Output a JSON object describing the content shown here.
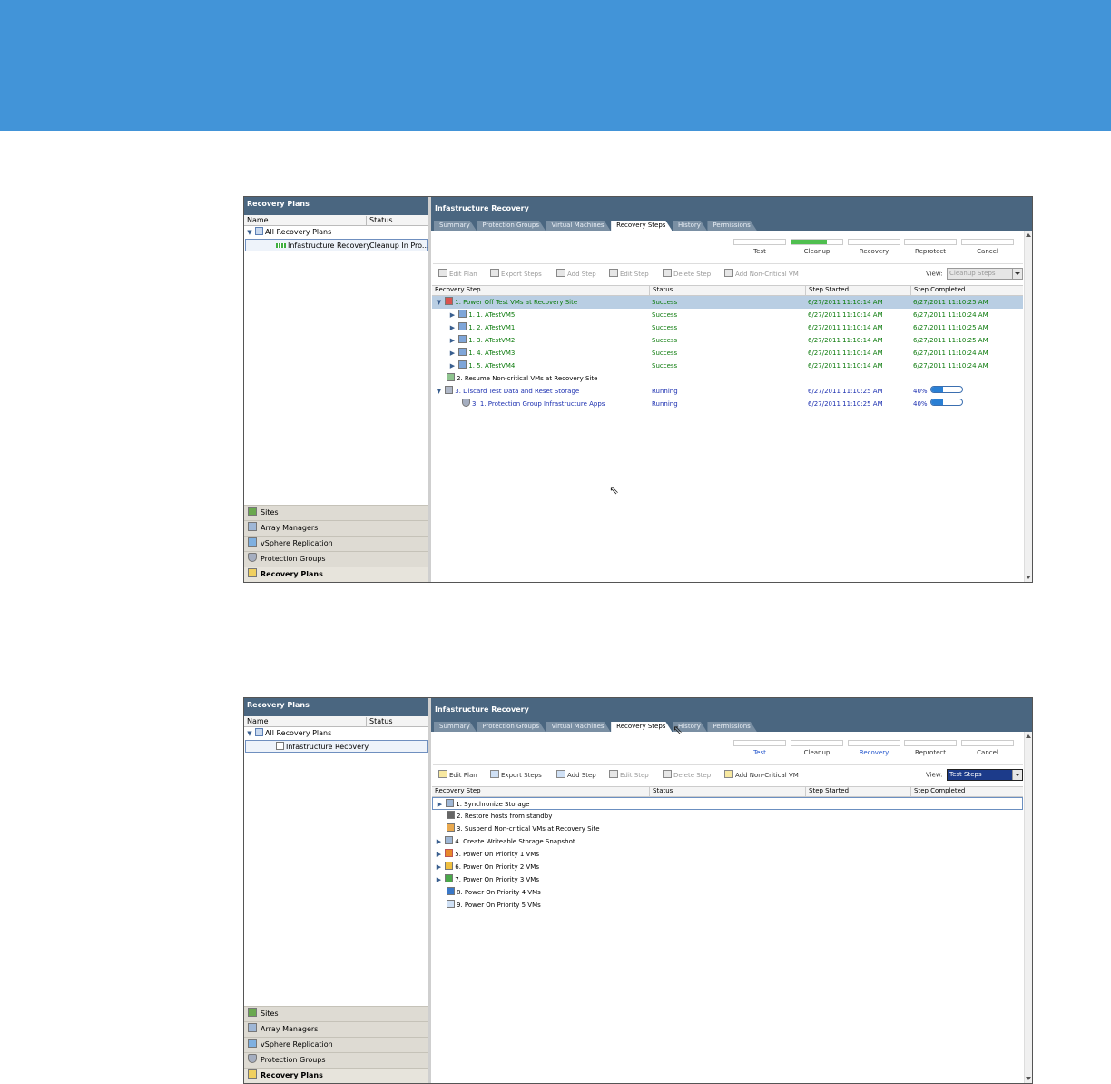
{
  "shots": [
    {
      "left": {
        "title": "Recovery Plans",
        "col_name": "Name",
        "col_status": "Status",
        "tree": [
          {
            "label": "All Recovery Plans",
            "status": ""
          },
          {
            "label": "Infastructure Recovery",
            "status": "Cleanup In Pro..."
          }
        ],
        "nav": [
          "Sites",
          "Array Managers",
          "vSphere Replication",
          "Protection Groups",
          "Recovery Plans"
        ]
      },
      "right": {
        "title": "Infastructure Recovery",
        "tabs": [
          "Summary",
          "Protection Groups",
          "Virtual Machines",
          "Recovery Steps",
          "History",
          "Permissions"
        ],
        "ops": [
          {
            "label": "Test",
            "progress": 0
          },
          {
            "label": "Cleanup",
            "progress": 0.7
          },
          {
            "label": "Recovery",
            "progress": 0
          },
          {
            "label": "Reprotect",
            "progress": 0
          },
          {
            "label": "Cancel",
            "progress": 0
          }
        ],
        "toolbar": [
          "Edit Plan",
          "Export Steps",
          "Add Step",
          "Edit Step",
          "Delete Step",
          "Add Non-Critical VM"
        ],
        "view_label": "View:",
        "view_value": "Cleanup Steps",
        "columns": [
          "Recovery Step",
          "Status",
          "Step Started",
          "Step Completed"
        ],
        "rows": [
          {
            "step": "1. Power Off Test VMs at Recovery Site",
            "status": "Success",
            "started": "6/27/2011 11:10:14 AM",
            "completed": "6/27/2011 11:10:25 AM"
          },
          {
            "step": "1. 1. ATestVM5",
            "status": "Success",
            "started": "6/27/2011 11:10:14 AM",
            "completed": "6/27/2011 11:10:24 AM"
          },
          {
            "step": "1. 2. ATestVM1",
            "status": "Success",
            "started": "6/27/2011 11:10:14 AM",
            "completed": "6/27/2011 11:10:25 AM"
          },
          {
            "step": "1. 3. ATestVM2",
            "status": "Success",
            "started": "6/27/2011 11:10:14 AM",
            "completed": "6/27/2011 11:10:25 AM"
          },
          {
            "step": "1. 4. ATestVM3",
            "status": "Success",
            "started": "6/27/2011 11:10:14 AM",
            "completed": "6/27/2011 11:10:24 AM"
          },
          {
            "step": "1. 5. ATestVM4",
            "status": "Success",
            "started": "6/27/2011 11:10:14 AM",
            "completed": "6/27/2011 11:10:24 AM"
          },
          {
            "step": "2. Resume Non-critical VMs at Recovery Site",
            "status": "",
            "started": "",
            "completed": ""
          },
          {
            "step": "3. Discard Test Data and Reset Storage",
            "status": "Running",
            "started": "6/27/2011 11:10:25 AM",
            "completed": "40%",
            "progress": 0.4
          },
          {
            "step": "3. 1. Protection Group Infrastructure Apps",
            "status": "Running",
            "started": "6/27/2011 11:10:25 AM",
            "completed": "40%",
            "progress": 0.4
          }
        ]
      }
    },
    {
      "left": {
        "title": "Recovery Plans",
        "col_name": "Name",
        "col_status": "Status",
        "tree": [
          {
            "label": "All Recovery Plans",
            "status": ""
          },
          {
            "label": "Infastructure Recovery",
            "status": ""
          }
        ],
        "nav": [
          "Sites",
          "Array Managers",
          "vSphere Replication",
          "Protection Groups",
          "Recovery Plans"
        ]
      },
      "right": {
        "title": "Infastructure Recovery",
        "tabs": [
          "Summary",
          "Protection Groups",
          "Virtual Machines",
          "Recovery Steps",
          "History",
          "Permissions"
        ],
        "ops": [
          {
            "label": "Test",
            "progress": 0
          },
          {
            "label": "Cleanup",
            "progress": 0
          },
          {
            "label": "Recovery",
            "progress": 0
          },
          {
            "label": "Reprotect",
            "progress": 0
          },
          {
            "label": "Cancel",
            "progress": 0
          }
        ],
        "toolbar": [
          "Edit Plan",
          "Export Steps",
          "Add Step",
          "Edit Step",
          "Delete Step",
          "Add Non-Critical VM"
        ],
        "view_label": "View:",
        "view_value": "Test Steps",
        "columns": [
          "Recovery Step",
          "Status",
          "Step Started",
          "Step Completed"
        ],
        "rows": [
          {
            "step": "1. Synchronize Storage"
          },
          {
            "step": "2. Restore hosts from standby"
          },
          {
            "step": "3. Suspend Non-critical VMs at Recovery Site"
          },
          {
            "step": "4. Create Writeable Storage Snapshot"
          },
          {
            "step": "5. Power On Priority 1 VMs"
          },
          {
            "step": "6. Power On Priority 2 VMs"
          },
          {
            "step": "7. Power On Priority 3 VMs"
          },
          {
            "step": "8. Power On Priority 4 VMs"
          },
          {
            "step": "9. Power On Priority 5 VMs"
          }
        ]
      }
    }
  ],
  "colors": {
    "brand_band": "#4294d8",
    "header": "#4a6680",
    "success": "#0a7a0a",
    "running": "#1b2fb0",
    "progress": "#2a7fd4"
  }
}
